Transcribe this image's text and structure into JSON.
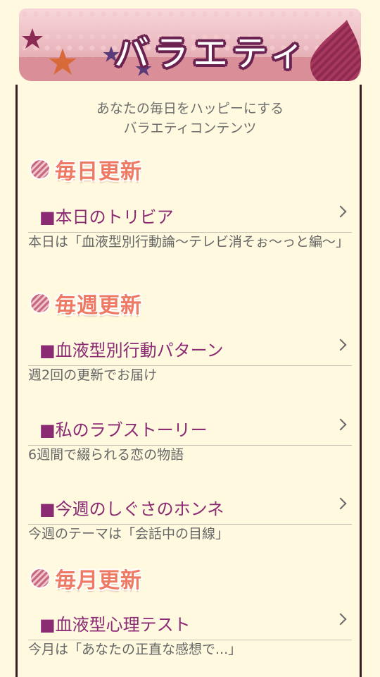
{
  "header": {
    "title": "バラエティ"
  },
  "intro": {
    "line1": "あなたの毎日をハッピーにする",
    "line2": "バラエティコンテンツ"
  },
  "sections": [
    {
      "title": "毎日更新",
      "items": [
        {
          "label": "■本日のトリビア",
          "desc": "本日は「血液型別行動論〜テレビ消そぉ〜っと編〜」"
        }
      ]
    },
    {
      "title": "毎週更新",
      "items": [
        {
          "label": "■血液型別行動パターン",
          "desc": "週2回の更新でお届け"
        },
        {
          "label": "■私のラブストーリー",
          "desc": "6週間で綴られる恋の物語"
        },
        {
          "label": "■今週のしぐさのホンネ",
          "desc": "今週のテーマは「会話中の目線」"
        }
      ]
    },
    {
      "title": "毎月更新",
      "items": [
        {
          "label": "■血液型心理テスト",
          "desc": "今月は「あなたの正直な感想で...」"
        }
      ]
    }
  ],
  "colors": {
    "accent": "#8b2b73",
    "section": "#ee7a64",
    "background": "#fff9df"
  }
}
